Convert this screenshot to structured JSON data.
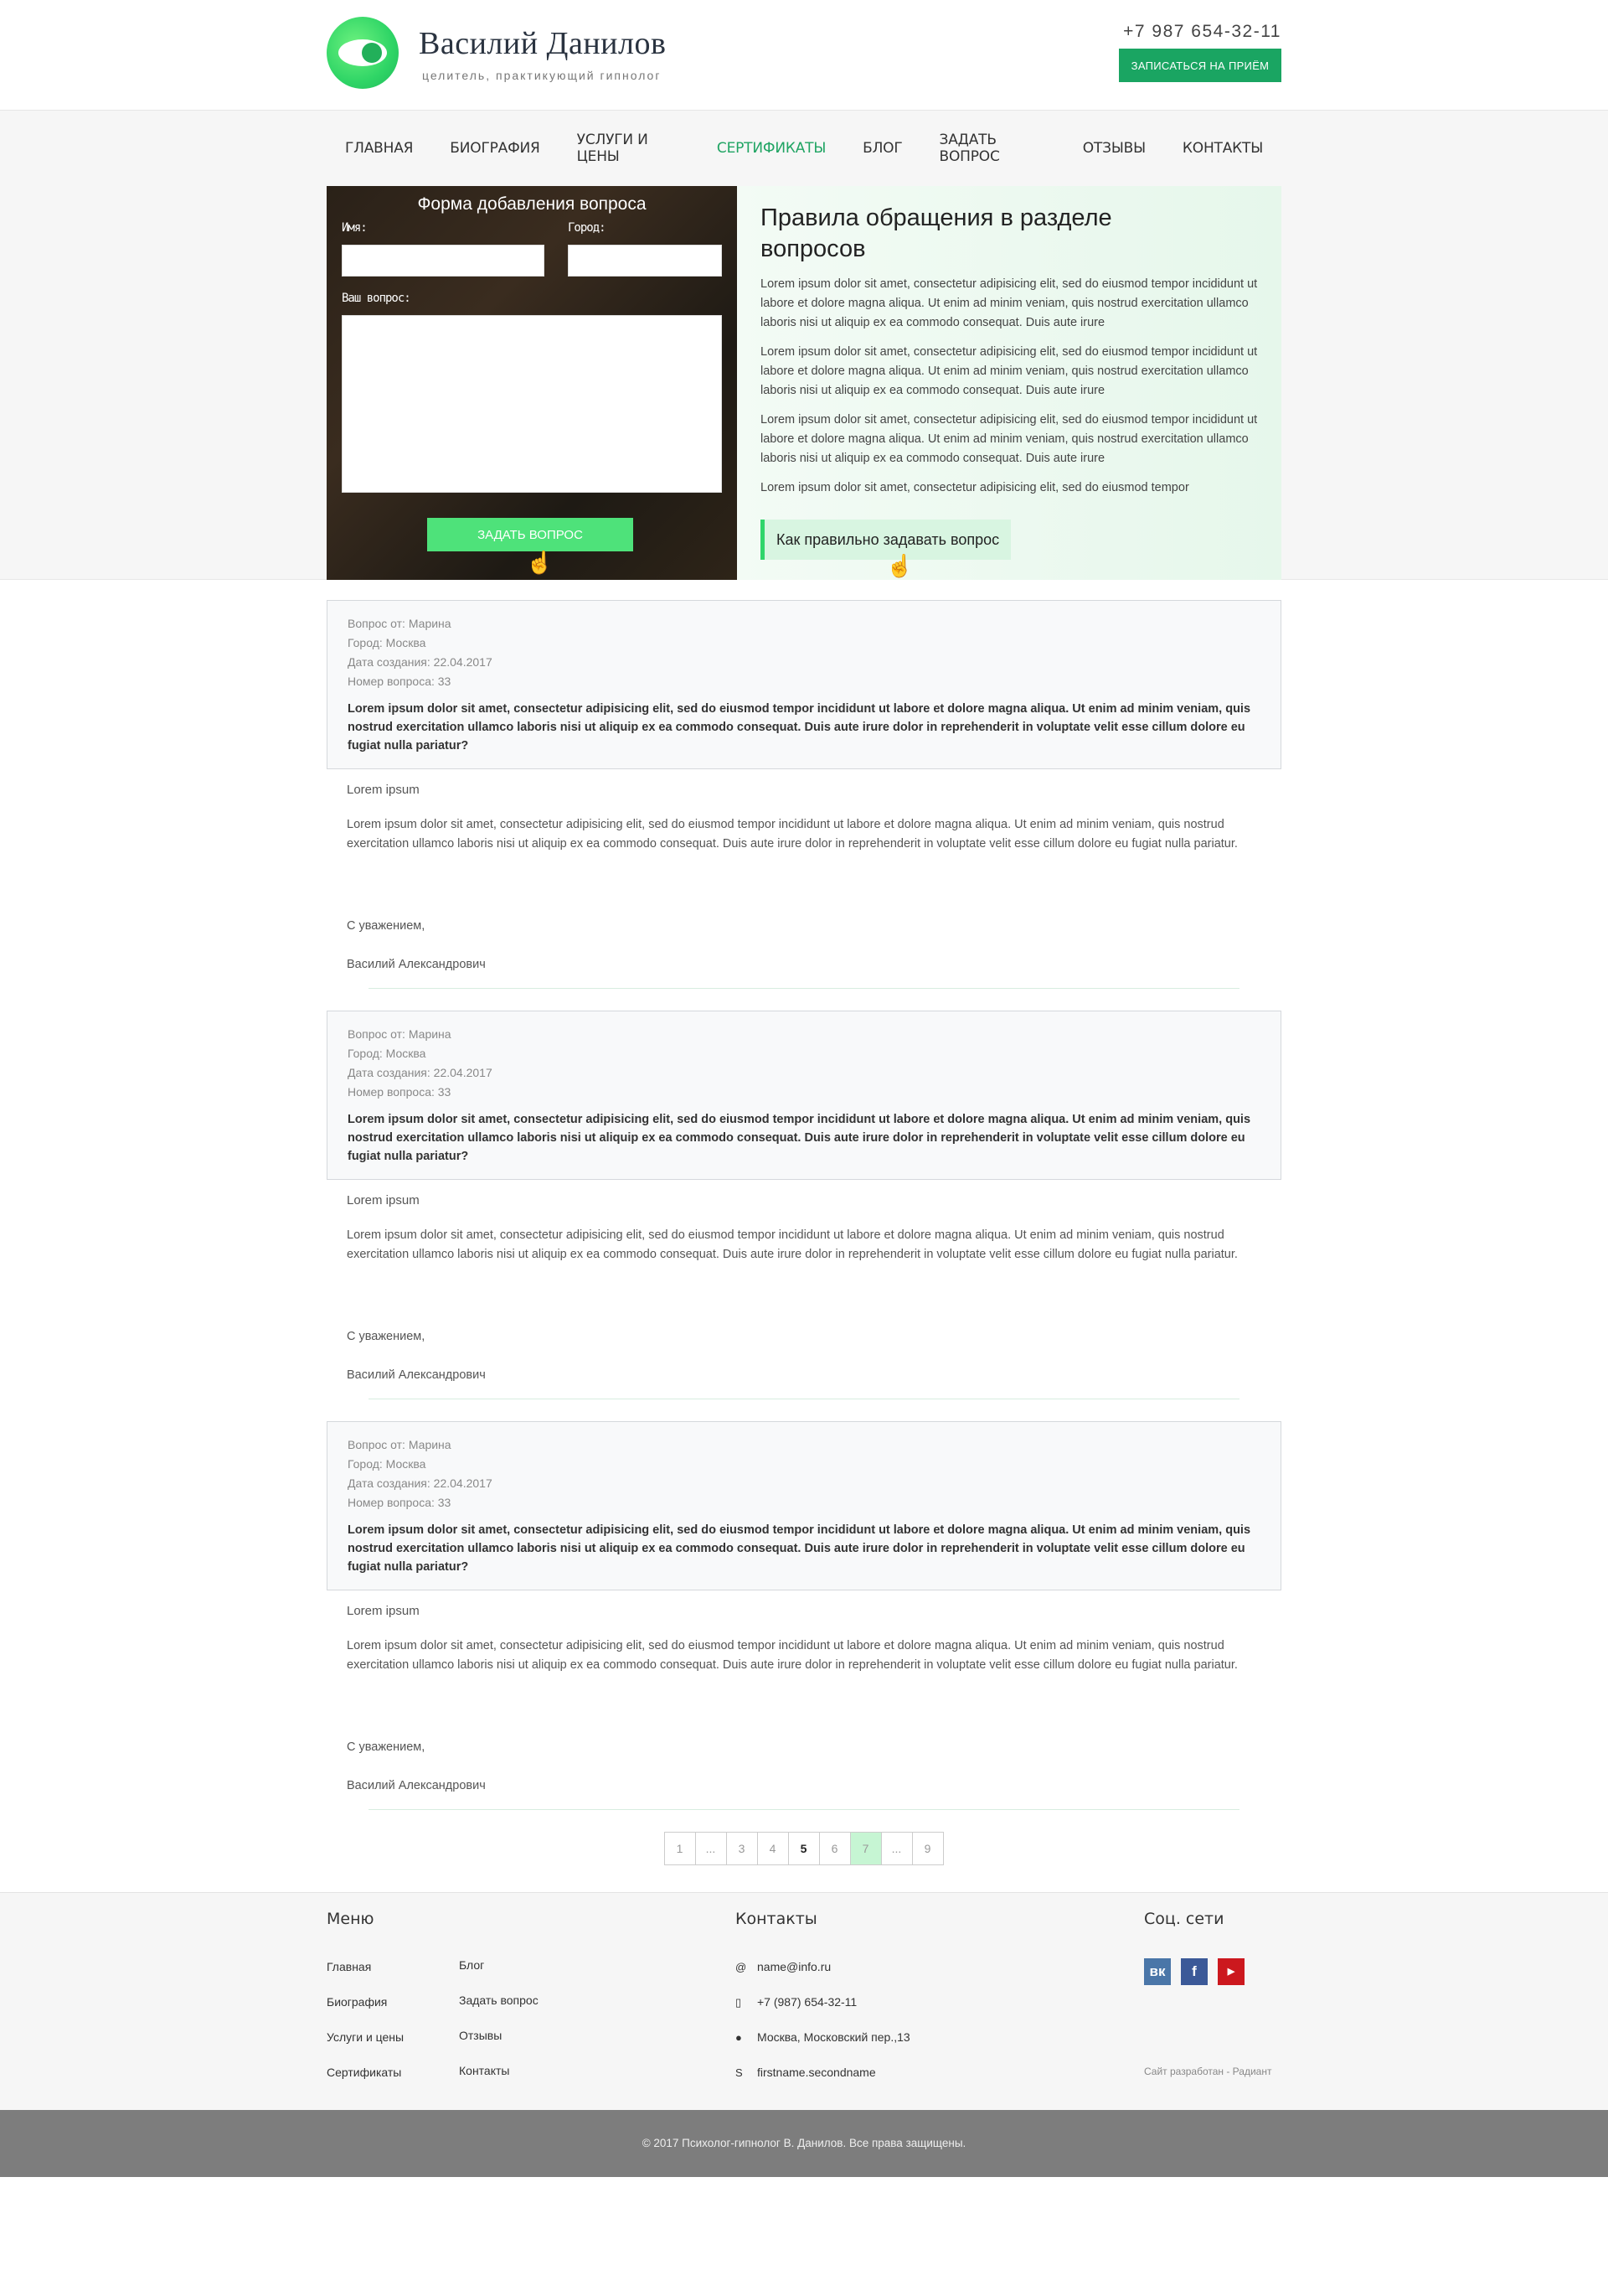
{
  "header": {
    "brand_name": "Василий Данилов",
    "brand_sub": "целитель, практикующий гипнолог",
    "phone": "+7 987 654-32-11",
    "cta": "ЗАПИСАТЬСЯ НА ПРИЁМ"
  },
  "nav": [
    {
      "label": "ГЛАВНАЯ"
    },
    {
      "label": "БИОГРАФИЯ"
    },
    {
      "label": "УСЛУГИ И ЦЕНЫ"
    },
    {
      "label": "СЕРТИФИКАТЫ",
      "active": true
    },
    {
      "label": "БЛОГ"
    },
    {
      "label": "ЗАДАТЬ ВОПРОС"
    },
    {
      "label": "ОТЗЫВЫ"
    },
    {
      "label": "КОНТАКТЫ"
    }
  ],
  "form": {
    "title": "Форма добавления вопроса",
    "name_label": "Имя:",
    "city_label": "Город:",
    "question_label": "Ваш вопрос:",
    "submit": "ЗАДАТЬ ВОПРОС"
  },
  "rules": {
    "title": "Правила обращения в разделе вопросов",
    "p1": "Lorem ipsum dolor sit amet, consectetur adipisicing elit, sed do eiusmod tempor incididunt ut labore et dolore magna aliqua. Ut enim ad minim veniam, quis nostrud exercitation ullamco laboris nisi ut aliquip ex ea commodo consequat. Duis aute irure",
    "p2": "Lorem ipsum dolor sit amet, consectetur adipisicing elit, sed do eiusmod tempor incididunt ut labore et dolore magna aliqua. Ut enim ad minim veniam, quis nostrud exercitation ullamco laboris nisi ut aliquip ex ea commodo consequat. Duis aute irure",
    "p3": "Lorem ipsum dolor sit amet, consectetur adipisicing elit, sed do eiusmod tempor incididunt ut labore et dolore magna aliqua. Ut enim ad minim veniam, quis nostrud exercitation ullamco laboris nisi ut aliquip ex ea commodo consequat. Duis aute irure",
    "p4": "Lorem ipsum dolor sit amet, consectetur adipisicing elit, sed do eiusmod tempor",
    "button": "Как правильно задавать вопрос"
  },
  "qa": [
    {
      "from": "Вопрос от: Марина",
      "city": "Город: Москва",
      "date": "Дата создания: 22.04.2017",
      "number": "Номер вопроса: 33",
      "question": "Lorem ipsum dolor sit amet, consectetur adipisicing elit, sed do eiusmod tempor incididunt ut labore et dolore magna aliqua. Ut enim ad minim veniam, quis nostrud exercitation ullamco laboris nisi ut aliquip ex ea commodo consequat. Duis aute irure dolor in reprehenderit in voluptate velit esse cillum dolore eu fugiat nulla pariatur?",
      "answer_head": "Lorem ipsum",
      "answer_body": "Lorem ipsum dolor sit amet, consectetur adipisicing elit, sed do eiusmod tempor incididunt ut labore et dolore magna aliqua. Ut enim ad minim veniam, quis nostrud exercitation ullamco laboris nisi ut aliquip ex ea commodo consequat. Duis aute irure dolor in reprehenderit in voluptate velit esse cillum dolore eu fugiat nulla pariatur.",
      "regards": "С уважением,",
      "sign": "Василий Александрович"
    },
    {
      "from": "Вопрос от: Марина",
      "city": "Город: Москва",
      "date": "Дата создания: 22.04.2017",
      "number": "Номер вопроса: 33",
      "question": "Lorem ipsum dolor sit amet, consectetur adipisicing elit, sed do eiusmod tempor incididunt ut labore et dolore magna aliqua. Ut enim ad minim veniam, quis nostrud exercitation ullamco laboris nisi ut aliquip ex ea commodo consequat. Duis aute irure dolor in reprehenderit in voluptate velit esse cillum dolore eu fugiat nulla pariatur?",
      "answer_head": "Lorem ipsum",
      "answer_body": "Lorem ipsum dolor sit amet, consectetur adipisicing elit, sed do eiusmod tempor incididunt ut labore et dolore magna aliqua. Ut enim ad minim veniam, quis nostrud exercitation ullamco laboris nisi ut aliquip ex ea commodo consequat. Duis aute irure dolor in reprehenderit in voluptate velit esse cillum dolore eu fugiat nulla pariatur.",
      "regards": "С уважением,",
      "sign": "Василий Александрович"
    },
    {
      "from": "Вопрос от: Марина",
      "city": "Город: Москва",
      "date": "Дата создания: 22.04.2017",
      "number": "Номер вопроса: 33",
      "question": "Lorem ipsum dolor sit amet, consectetur adipisicing elit, sed do eiusmod tempor incididunt ut labore et dolore magna aliqua. Ut enim ad minim veniam, quis nostrud exercitation ullamco laboris nisi ut aliquip ex ea commodo consequat. Duis aute irure dolor in reprehenderit in voluptate velit esse cillum dolore eu fugiat nulla pariatur?",
      "answer_head": "Lorem ipsum",
      "answer_body": "Lorem ipsum dolor sit amet, consectetur adipisicing elit, sed do eiusmod tempor incididunt ut labore et dolore magna aliqua. Ut enim ad minim veniam, quis nostrud exercitation ullamco laboris nisi ut aliquip ex ea commodo consequat. Duis aute irure dolor in reprehenderit in voluptate velit esse cillum dolore eu fugiat nulla pariatur.",
      "regards": "С уважением,",
      "sign": "Василий Александрович"
    }
  ],
  "pagination": [
    "1",
    "...",
    "3",
    "4",
    "5",
    "6",
    "7",
    "...",
    "9"
  ],
  "pagination_current": "5",
  "pagination_hover": "7",
  "footer": {
    "menu_title": "Меню",
    "menu_col1": [
      "Главная",
      "Биография",
      "Услуги и цены",
      "Сертификаты"
    ],
    "menu_col2": [
      "Блог",
      "Задать вопрос",
      "Отзывы",
      "Контакты"
    ],
    "contacts_title": "Контакты",
    "email": "name@info.ru",
    "phone": "+7 (987) 654-32-11",
    "address": "Москва, Московский  пер.,13",
    "skype": "firstname.secondname",
    "social_title": "Соц. сети",
    "credit": "Сайт разработан - Радиант",
    "copyright": "© 2017 Психолог-гипнолог В. Данилов. Все права защищены."
  },
  "colors": {
    "accent": "#1aa562",
    "accent_light": "#4ee27a",
    "vk": "#4a76a8",
    "facebook": "#3b5998",
    "youtube": "#cc181e"
  }
}
